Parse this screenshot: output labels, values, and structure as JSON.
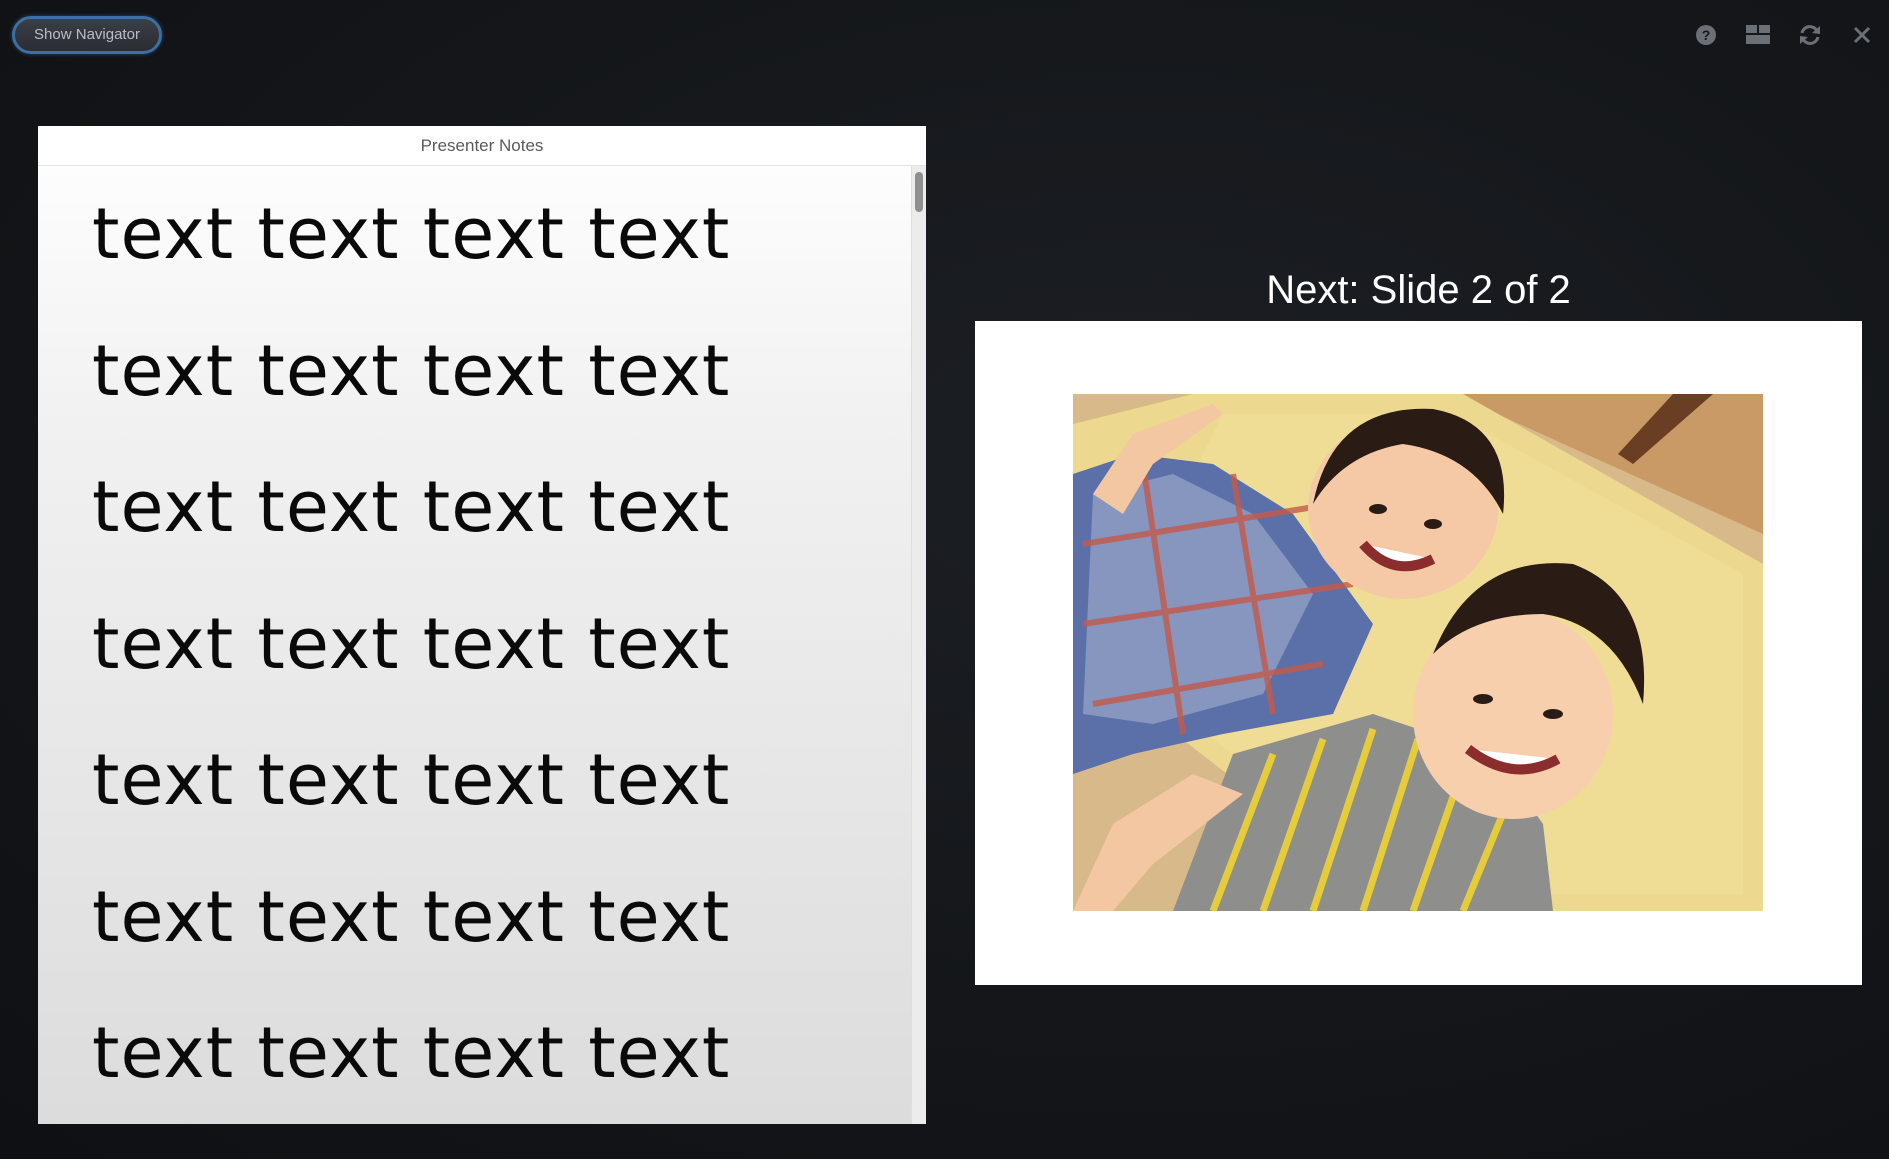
{
  "navigator_button": {
    "label": "Show Navigator"
  },
  "toolbar": {
    "icons": [
      "help-icon",
      "layout-icon",
      "refresh-icon",
      "close-icon"
    ]
  },
  "notes": {
    "title": "Presenter Notes",
    "lines": [
      "text text text text",
      "text text text text",
      "text text text text",
      "text text text text",
      "text text text text",
      "text text text text",
      "text text text text"
    ]
  },
  "next": {
    "label": "Next: Slide 2 of 2"
  },
  "colors": {
    "background": "#15171b",
    "accent": "#3d6fa6"
  }
}
